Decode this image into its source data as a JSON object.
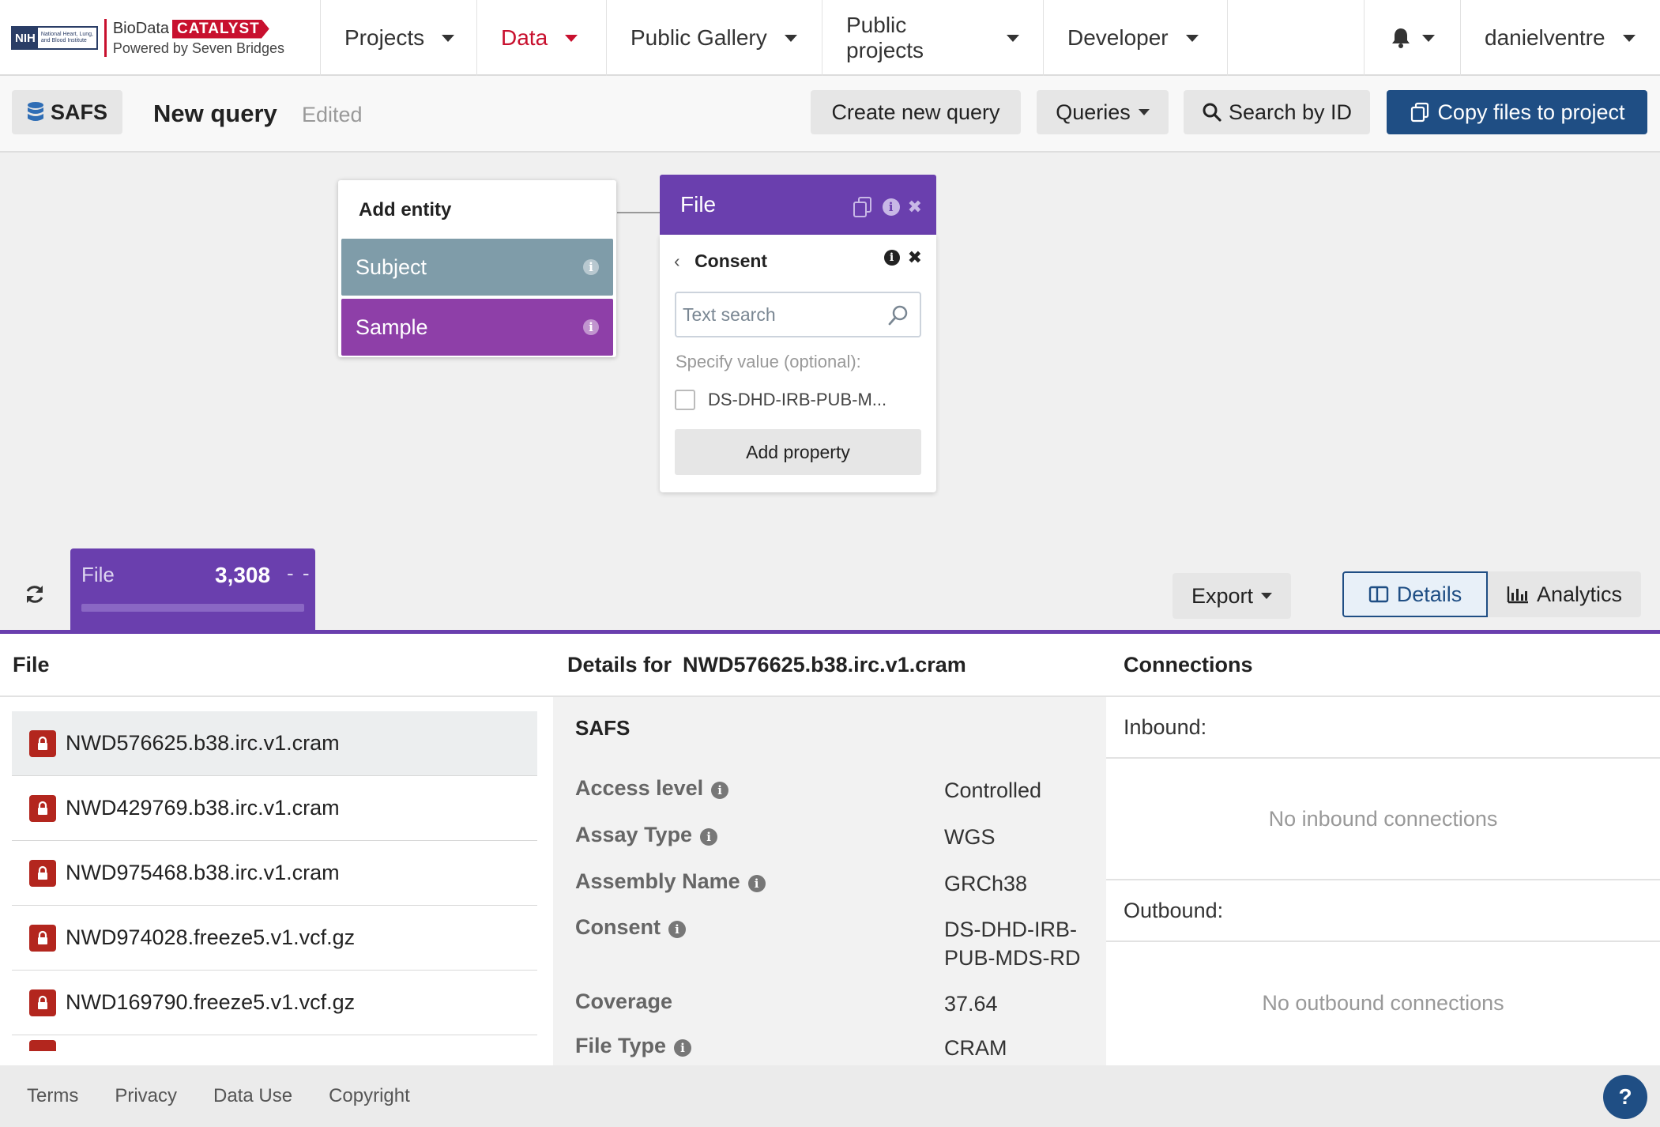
{
  "logo": {
    "nih": "NIH",
    "institute": "National Heart, Lung, and Blood Institute",
    "brand_name": "BioData",
    "brand_highlight": "CATALYST",
    "powered_by": "Powered by Seven Bridges"
  },
  "nav": {
    "items": [
      {
        "label": "Projects"
      },
      {
        "label": "Data"
      },
      {
        "label": "Public Gallery"
      },
      {
        "label": "Public projects"
      },
      {
        "label": "Developer"
      }
    ],
    "user": "danielventre"
  },
  "toolbar": {
    "safs_label": "SAFS",
    "query_title": "New query",
    "query_status": "Edited",
    "create_new_query": "Create new query",
    "queries": "Queries",
    "search_by_id": "Search by ID",
    "copy_files": "Copy files to project"
  },
  "canvas": {
    "add_entity": {
      "title": "Add entity",
      "items": [
        {
          "label": "Subject"
        },
        {
          "label": "Sample"
        }
      ]
    },
    "file_node": {
      "label": "File"
    },
    "consent": {
      "title": "Consent",
      "search_placeholder": "Text search",
      "specify_label": "Specify value (optional):",
      "option": "DS-DHD-IRB-PUB-M...",
      "add_property": "Add property"
    }
  },
  "results": {
    "tab_label": "File",
    "count": "3,308",
    "dash": "- -",
    "export": "Export",
    "details": "Details",
    "analytics": "Analytics"
  },
  "file_panel": {
    "header": "File",
    "files": [
      "NWD576625.b38.irc.v1.cram",
      "NWD429769.b38.irc.v1.cram",
      "NWD975468.b38.irc.v1.cram",
      "NWD974028.freeze5.v1.vcf.gz",
      "NWD169790.freeze5.v1.vcf.gz"
    ]
  },
  "details_panel": {
    "header_prefix": "Details for",
    "header_file": "NWD576625.b38.irc.v1.cram",
    "section": "SAFS",
    "rows": [
      {
        "key": "Access level",
        "value": "Controlled"
      },
      {
        "key": "Assay Type",
        "value": "WGS"
      },
      {
        "key": "Assembly Name",
        "value": "GRCh38"
      },
      {
        "key": "Consent",
        "value": "DS-DHD-IRB-PUB-MDS-RD"
      },
      {
        "key": "Coverage",
        "value": "37.64"
      },
      {
        "key": "File Type",
        "value": "CRAM"
      }
    ]
  },
  "connections_panel": {
    "header": "Connections",
    "inbound_label": "Inbound:",
    "inbound_empty": "No inbound connections",
    "outbound_label": "Outbound:",
    "outbound_empty": "No outbound connections"
  },
  "footer": {
    "links": [
      "Terms",
      "Privacy",
      "Data Use",
      "Copyright"
    ],
    "help": "?"
  },
  "colors": {
    "brand_red": "#c8102e",
    "primary_blue": "#1f4e84",
    "file_purple": "#6a3fae",
    "subject_slate": "#7f9ca9",
    "sample_purple": "#8e3fa8",
    "lock_red": "#b3261e"
  }
}
